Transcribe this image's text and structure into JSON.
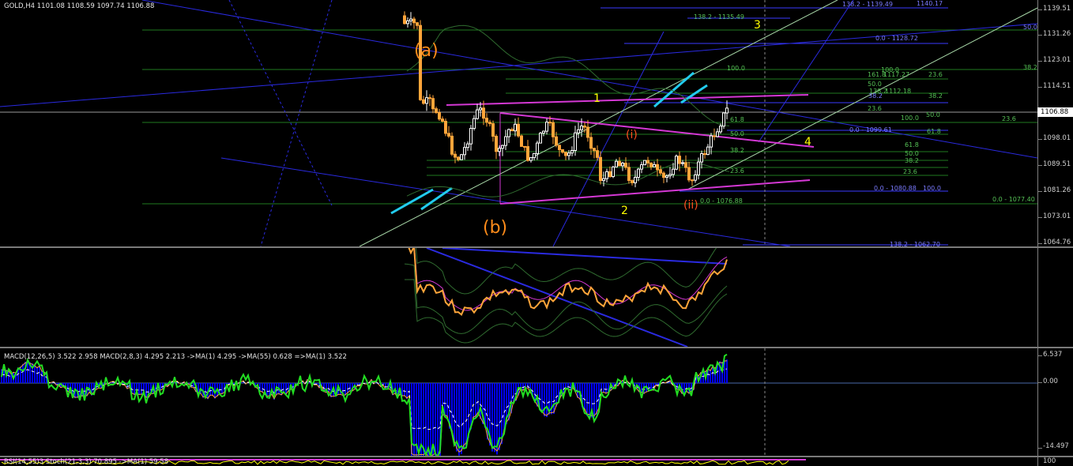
{
  "symbol_header": "GOLD,H4  1101.08 1108.59 1097.74 1106.88",
  "price_scale": {
    "labels": [
      "1139.51",
      "1131.26",
      "1123.01",
      "1114.51",
      "1106.88",
      "1098.01",
      "1089.51",
      "1081.26",
      "1073.01",
      "1064.76"
    ],
    "current": "1106.88"
  },
  "macd_pane": {
    "title": "MACD(12,26,5) 3.522 2.958  MACD(2,8,3) 4.295 2.213  ->MA(1) 4.295  ->MA(55) 0.628  =>MA(1) 3.522",
    "scale": [
      "6.537",
      "0.00",
      "-14.497"
    ]
  },
  "stoch_pane": {
    "title": "RSI(14,55)3  Stoch(21,3,3) 70.895  ->MA(1) 59.58",
    "scale": [
      "100"
    ]
  },
  "fib_labels": [
    "138.2 - 1135.49",
    "138.2 - 1139.49",
    "1140.17",
    "100.0",
    "0.0 - 1128.72",
    "50.0",
    "38.2",
    "100.0",
    "161.8",
    "1117.27",
    "23.6",
    "50.0",
    "138.2",
    "1112.18",
    "38.2",
    "38.2",
    "23.6",
    "50.0",
    "100.0",
    "23.6",
    "61.8",
    "0.0 - 1099.61",
    "61.8",
    "50.0",
    "38.2",
    "61.8",
    "50.0",
    "38.2",
    "23.6",
    "23.6",
    "0.0 - 1080.88",
    "100.0",
    "0.0 - 1076.88",
    "0.0 - 1077.40",
    "138.2 - 1062.70"
  ],
  "wave_labels": {
    "a": "(a)",
    "b": "(b)",
    "w1": "1",
    "w2": "2",
    "w3": "3",
    "w4": "4",
    "i": "(i)",
    "ii": "(ii)"
  },
  "colors": {
    "background": "#000000",
    "candle_up": "#ffffff",
    "candle_down": "#ffa53a",
    "trendline": "#2a2ae0",
    "channel": "#d438d4",
    "fib": "#1f7a1f",
    "fib_blue": "#3a3aff",
    "wave_yellow": "#ffff00",
    "wave_orange": "#ff8c1a",
    "macd_hist": "#0000ff",
    "macd_line": "#22dd22"
  }
}
